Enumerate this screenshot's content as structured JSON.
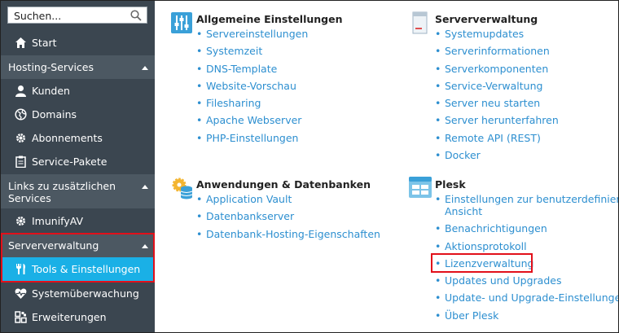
{
  "sidebar": {
    "search_placeholder": "Suchen...",
    "start_label": "Start",
    "hosting_group": "Hosting-Services",
    "hosting_items": [
      "Kunden",
      "Domains",
      "Abonnements",
      "Service-Pakete"
    ],
    "links_group_line1": "Links zu zusätzlichen",
    "links_group_line2": "Services",
    "links_items": [
      "ImunifyAV"
    ],
    "server_group": "Serververwaltung",
    "server_items": [
      "Tools & Einstellungen",
      "Systemüberwachung",
      "Erweiterungen"
    ]
  },
  "sections": {
    "general": {
      "title": "Allgemeine Einstellungen",
      "links": [
        "Servereinstellungen",
        "Systemzeit",
        "DNS-Template",
        "Website-Vorschau",
        "Filesharing",
        "Apache Webserver",
        "PHP-Einstellungen"
      ]
    },
    "server": {
      "title": "Serververwaltung",
      "links": [
        "Systemupdates",
        "Serverinformationen",
        "Serverkomponenten",
        "Service-Verwaltung",
        "Server neu starten",
        "Server herunterfahren",
        "Remote API (REST)",
        "Docker"
      ]
    },
    "apps": {
      "title": "Anwendungen & Datenbanken",
      "links": [
        "Application Vault",
        "Datenbankserver",
        "Datenbank-Hosting-Eigenschaften"
      ]
    },
    "plesk": {
      "title": "Plesk",
      "links": [
        "Einstellungen zur benutzerdefinierten",
        "Ansicht",
        "Benachrichtigungen",
        "Aktionsprotokoll",
        "Lizenzverwaltung",
        "Updates und Upgrades",
        "Update- und Upgrade-Einstellungen",
        "Über Plesk"
      ]
    }
  },
  "colors": {
    "sidebar_bg": "#3b4650",
    "group_bg": "#4c5862",
    "active_bg": "#1ab0e6",
    "link": "#2d8fd0",
    "highlight": "#e2101a"
  }
}
